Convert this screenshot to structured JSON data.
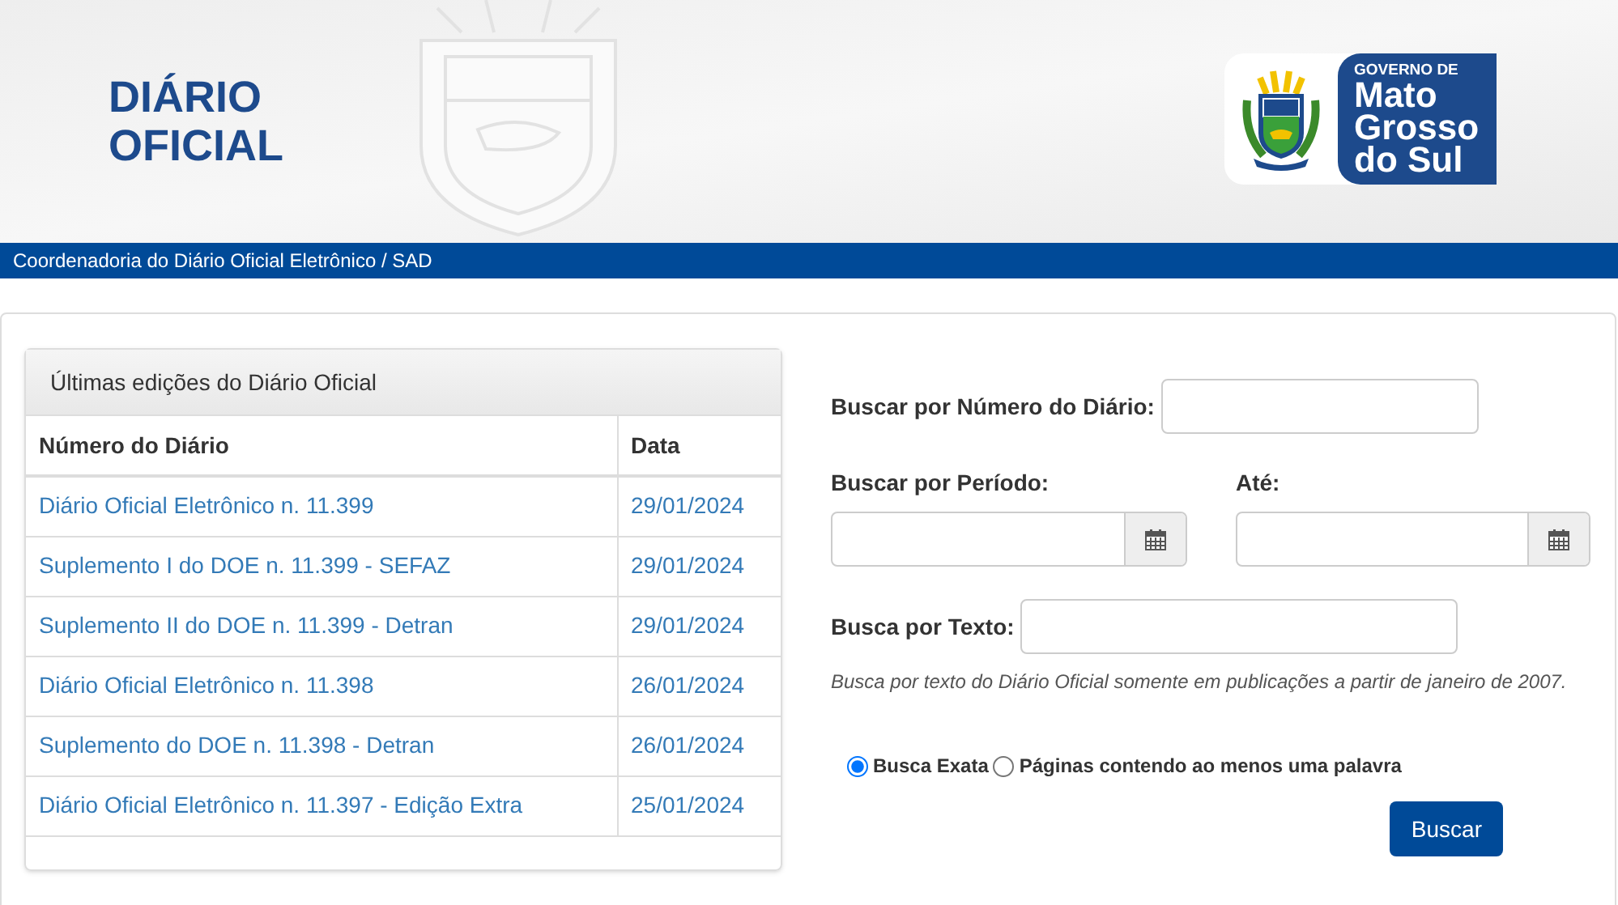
{
  "header": {
    "title_line_1": "DIÁRIO",
    "title_line_2": "OFICIAL",
    "logo": {
      "line_1": "GOVERNO DE",
      "line_2": "Mato",
      "line_3": "Grosso",
      "line_4": "do Sul"
    }
  },
  "subtitle_bar": "Coordenadoria do Diário Oficial Eletrônico / SAD",
  "editions": {
    "title": "Últimas edições do Diário Oficial",
    "columns": [
      "Número do Diário",
      "Data"
    ],
    "rows": [
      {
        "name": "Diário Oficial Eletrônico n. 11.399",
        "date": "29/01/2024"
      },
      {
        "name": "Suplemento I do DOE n. 11.399 - SEFAZ",
        "date": "29/01/2024"
      },
      {
        "name": "Suplemento II do DOE n. 11.399 - Detran",
        "date": "29/01/2024"
      },
      {
        "name": "Diário Oficial Eletrônico n. 11.398",
        "date": "26/01/2024"
      },
      {
        "name": "Suplemento do DOE n. 11.398 - Detran",
        "date": "26/01/2024"
      },
      {
        "name": "Diário Oficial Eletrônico n. 11.397 - Edição Extra",
        "date": "25/01/2024"
      }
    ]
  },
  "search": {
    "number_label": "Buscar por Número do Diário:",
    "period_label": "Buscar por Período:",
    "until_label": "Até:",
    "text_label": "Busca por Texto:",
    "hint": "Busca por texto do Diário Oficial somente em publicações a partir de janeiro de 2007.",
    "options": [
      {
        "label": "Busca Exata",
        "selected": true
      },
      {
        "label": "Páginas contendo ao menos uma palavra",
        "selected": false
      }
    ],
    "button": "Buscar"
  }
}
